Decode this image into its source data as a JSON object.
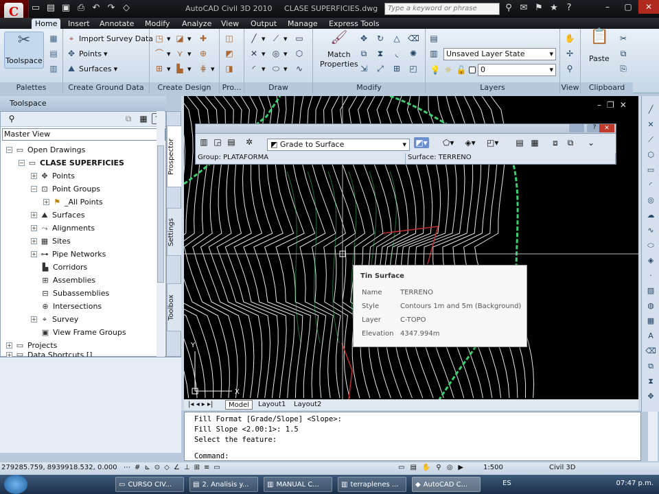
{
  "title_bar": {
    "app": "AutoCAD Civil 3D 2010",
    "file": "CLASE SUPERFICIES.dwg",
    "search_placeholder": "Type a keyword or phrase"
  },
  "ribbon_tabs": [
    "Home",
    "Insert",
    "Annotate",
    "Modify",
    "Analyze",
    "View",
    "Output",
    "Manage",
    "Express Tools"
  ],
  "ribbon": {
    "toolspace_label": "Toolspace",
    "import_survey": "Import Survey Data",
    "points": "Points",
    "surfaces": "Surfaces",
    "match_properties_1": "Match",
    "match_properties_2": "Properties",
    "layer_state": "Unsaved Layer State",
    "layer_current": "0",
    "paste": "Paste",
    "panels": {
      "palettes": "Palettes",
      "create_ground": "Create Ground Data",
      "create_design": "Create Design",
      "pro": "Pro...",
      "draw": "Draw",
      "modify": "Modify",
      "layers": "Layers",
      "view": "View",
      "clipboard": "Clipboard"
    }
  },
  "toolspace": {
    "title": "Toolspace",
    "master_view": "Master View",
    "tree": {
      "open_drawings": "Open Drawings",
      "drawing": "CLASE SUPERFICIES",
      "points": "Points",
      "point_groups": "Point Groups",
      "all_points": "_All Points",
      "surfaces": "Surfaces",
      "alignments": "Alignments",
      "sites": "Sites",
      "pipe_networks": "Pipe Networks",
      "corridors": "Corridors",
      "assemblies": "Assemblies",
      "subassemblies": "Subassemblies",
      "intersections": "Intersections",
      "survey": "Survey",
      "view_frame_groups": "View Frame Groups",
      "projects": "Projects",
      "data_shortcuts": "Data Shortcuts []"
    },
    "vertical_tabs": [
      "Prospector",
      "Settings",
      "Toolbox"
    ]
  },
  "grading_toolbar": {
    "method": "Grade to Surface",
    "group": "Group: PLATAFORMA",
    "surface": "Surface: TERRENO"
  },
  "tooltip": {
    "header": "Tin Surface",
    "rows": [
      {
        "k": "Name",
        "v": "TERRENO"
      },
      {
        "k": "Style",
        "v": "Contours 1m and 5m (Background)"
      },
      {
        "k": "Layer",
        "v": "C-TOPO"
      },
      {
        "k": "Elevation",
        "v": "4347.994m"
      }
    ]
  },
  "layout_tabs": [
    "Model",
    "Layout1",
    "Layout2"
  ],
  "command_lines": [
    "Fill Format [Grade/Slope] <Slope>:",
    "Fill Slope <2.00:1>: 1.5",
    "Select the feature:",
    "",
    "Command:"
  ],
  "status": {
    "coords": "279285.759, 8939918.532, 0.000",
    "scale": "1:500",
    "workspace": "Civil 3D"
  },
  "taskbar": {
    "items": [
      "CURSO CIV...",
      "2. Analisis y...",
      "MANUAL C...",
      "terraplenes ...",
      "AutoCAD C..."
    ],
    "lang": "ES",
    "time": "07:47 p.m."
  },
  "colors": {
    "canvas": "#000000",
    "contour": "#e8e8e8",
    "boundary": "#3bd16f",
    "feature": "#c03030",
    "ribbon": "#dbe6f1"
  }
}
